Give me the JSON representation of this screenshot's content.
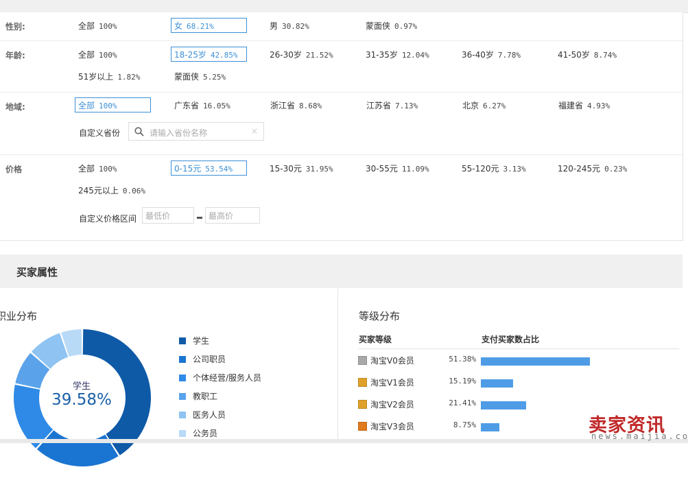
{
  "filters": {
    "gender": {
      "label": "性别:",
      "options": [
        {
          "name": "全部",
          "pct": "100%"
        },
        {
          "name": "女",
          "pct": "68.21%"
        },
        {
          "name": "男",
          "pct": "30.82%"
        },
        {
          "name": "蒙面侠",
          "pct": "0.97%"
        }
      ]
    },
    "age": {
      "label": "年龄:",
      "options": [
        {
          "name": "全部",
          "pct": "100%"
        },
        {
          "name": "18-25岁",
          "pct": "42.85%"
        },
        {
          "name": "26-30岁",
          "pct": "21.52%"
        },
        {
          "name": "31-35岁",
          "pct": "12.04%"
        },
        {
          "name": "36-40岁",
          "pct": "7.78%"
        },
        {
          "name": "41-50岁",
          "pct": "8.74%"
        },
        {
          "name": "51岁以上",
          "pct": "1.82%"
        },
        {
          "name": "蒙面侠",
          "pct": "5.25%"
        }
      ]
    },
    "region": {
      "label": "地域:",
      "options": [
        {
          "name": "全部",
          "pct": "100%"
        },
        {
          "name": "广东省",
          "pct": "16.05%"
        },
        {
          "name": "浙江省",
          "pct": "8.68%"
        },
        {
          "name": "江苏省",
          "pct": "7.13%"
        },
        {
          "name": "北京",
          "pct": "6.27%"
        },
        {
          "name": "福建省",
          "pct": "4.93%"
        }
      ],
      "custom_label": "自定义省份",
      "search_placeholder": "请输入省份名称",
      "clear_glyph": "×"
    },
    "price": {
      "label": "价格",
      "options": [
        {
          "name": "全部",
          "pct": "100%"
        },
        {
          "name": "0-15元",
          "pct": "53.54%"
        },
        {
          "name": "15-30元",
          "pct": "31.95%"
        },
        {
          "name": "30-55元",
          "pct": "11.09%"
        },
        {
          "name": "55-120元",
          "pct": "3.13%"
        },
        {
          "name": "120-245元",
          "pct": "0.23%"
        },
        {
          "name": "245元以上",
          "pct": "0.06%"
        }
      ],
      "custom_label": "自定义价格区间",
      "min_placeholder": "最低价",
      "max_placeholder": "最高价"
    }
  },
  "buyer_section": {
    "title": "买家属性",
    "occupation": {
      "title": "职业分布",
      "center_label": "学生",
      "center_pct": "39.58%",
      "legend": [
        {
          "name": "学生",
          "color": "#0e5aa7"
        },
        {
          "name": "公司职员",
          "color": "#1a74d1"
        },
        {
          "name": "个体经营/服务人员",
          "color": "#2e8ae6"
        },
        {
          "name": "教职工",
          "color": "#5aa3ea"
        },
        {
          "name": "医务人员",
          "color": "#8ec3f2"
        },
        {
          "name": "公务员",
          "color": "#b9daf7"
        }
      ]
    },
    "level": {
      "title": "等级分布",
      "col_level": "买家等级",
      "col_ratio": "支付买家数占比",
      "rows": [
        {
          "name": "淘宝V0会员",
          "pct": "51.38%",
          "value": 51.38,
          "badge_color": "#a9a9a9"
        },
        {
          "name": "淘宝V1会员",
          "pct": "15.19%",
          "value": 15.19,
          "badge_color": "#e0a12a"
        },
        {
          "name": "淘宝V2会员",
          "pct": "21.41%",
          "value": 21.41,
          "badge_color": "#e0a12a"
        },
        {
          "name": "淘宝V3会员",
          "pct": "8.75%",
          "value": 8.75,
          "badge_color": "#e07b1e"
        }
      ]
    }
  },
  "chart_data": {
    "type": "pie",
    "title": "职业分布",
    "categories": [
      "学生",
      "公司职员",
      "个体经营/服务人员",
      "教职工",
      "医务人员",
      "公务员"
    ],
    "values": [
      39.58,
      20,
      16,
      8,
      8,
      5
    ],
    "annotations": [
      "学生 39.58%"
    ]
  },
  "watermark": {
    "main": "卖家资讯",
    "sub": "news.maijia.com"
  }
}
